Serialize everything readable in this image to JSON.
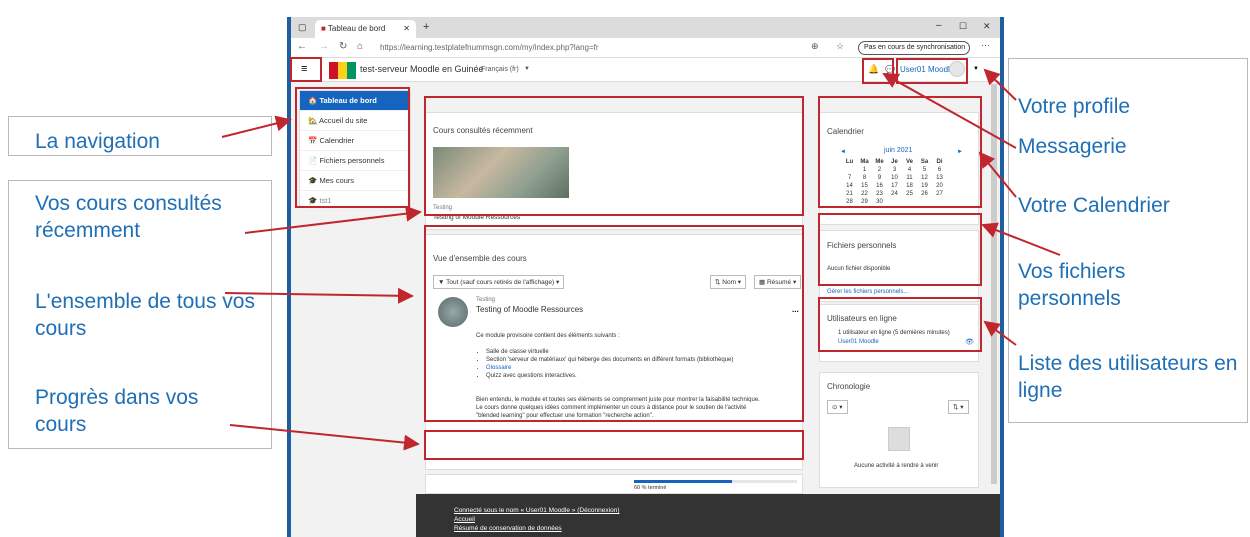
{
  "browser": {
    "tab_title": "Tableau de bord",
    "url": "https://learning.testplatefnummsgn.com/my/index.php?lang=fr",
    "sync_label": "Pas en cours de synchronisation"
  },
  "site": {
    "name": "test-serveur Moodle en Guinée",
    "language": "Français (fr)",
    "user": "User01 Moodle"
  },
  "nav": {
    "items": [
      "Tableau de bord",
      "Accueil du site",
      "Calendrier",
      "Fichiers personnels",
      "Mes cours"
    ],
    "extra": "tst1"
  },
  "recent": {
    "title": "Cours consultés récemment",
    "category": "Testing",
    "course": "Testing of Moodle Ressources"
  },
  "overview": {
    "title": "Vue d'ensemble des cours",
    "filter": "Tout (sauf cours retirés de l'affichage)",
    "sort": "Nom",
    "view": "Résumé",
    "category": "Testing",
    "course": "Testing of Moodle Ressources",
    "more": "...",
    "intro": "Ce module provisoire contient des éléments suivants :",
    "bullets": [
      "Salle de classe virtuelle",
      "Section 'serveur de matériaux' qui héberge des documents en différent formats (bibliothèque)",
      "Glossaire",
      "Quizz avec questions interactives."
    ],
    "para1": "Bien entendu, le module et toutes ses éléments se comprennent juste pour montrer la faisabilité technique.",
    "para2": "Le cours donne quelques idées comment implémenter un cours à distance pour le soutien de l'activité",
    "para3": "\"blended learning\" pour effectuer une formation \"recherche action\".",
    "progress_label": "60 % terminé",
    "progress": 0.6
  },
  "calendar": {
    "title": "Calendrier",
    "month": "juin 2021",
    "prev": "◄",
    "next": "►",
    "days": [
      "Lu",
      "Ma",
      "Me",
      "Je",
      "Ve",
      "Sa",
      "Di"
    ],
    "weeks": [
      [
        "",
        "1",
        "2",
        "3",
        "4",
        "5",
        "6"
      ],
      [
        "7",
        "8",
        "9",
        "10",
        "11",
        "12",
        "13"
      ],
      [
        "14",
        "15",
        "16",
        "17",
        "18",
        "19",
        "20"
      ],
      [
        "21",
        "22",
        "23",
        "24",
        "25",
        "26",
        "27"
      ],
      [
        "28",
        "29",
        "30",
        "",
        "",
        "",
        ""
      ]
    ]
  },
  "files": {
    "title": "Fichiers personnels",
    "empty": "Aucun fichier disponible",
    "manage": "Gérer les fichiers personnels..."
  },
  "online": {
    "title": "Utilisateurs en ligne",
    "count": "1 utilisateur en ligne (5 dernières minutes)",
    "user": "User01 Moodle"
  },
  "timeline": {
    "title": "Chronologie",
    "empty": "Aucune activité à rendre à venir"
  },
  "footer": {
    "logged": "Connecté sous le nom « User01 Moodle » (Déconnexion)",
    "home": "Accueil",
    "privacy": "Résumé de conservation de données"
  },
  "labels": {
    "navigation": "La navigation",
    "recent": "Vos cours consultés récemment",
    "all_courses": "L'ensemble de tous vos cours",
    "progress": "Progrès dans vos cours",
    "profile": "Votre profile",
    "messaging": "Messagerie",
    "calendar": "Votre Calendrier",
    "files": "Vos fichiers personnels",
    "online": "Liste des utilisateurs en ligne"
  }
}
